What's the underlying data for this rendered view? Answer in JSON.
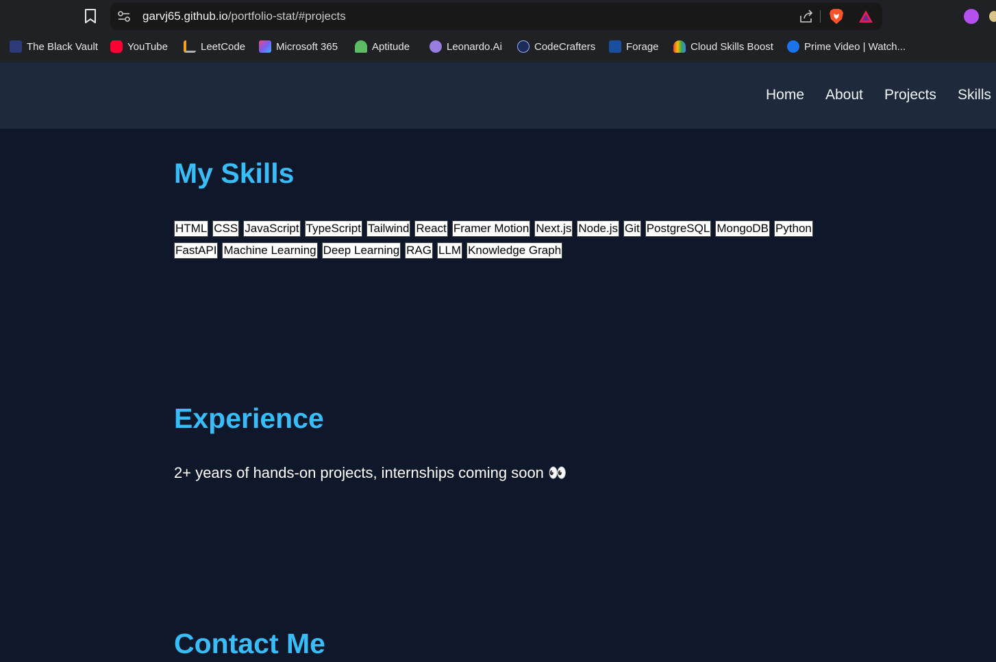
{
  "browser": {
    "url_host": "garvj65.github.io",
    "url_path": "/portfolio-stat/#projects"
  },
  "bookmarks": [
    {
      "label": "The Black Vault",
      "color": "#3a4a8a",
      "icon": "black-vault-icon"
    },
    {
      "label": "YouTube",
      "color": "#ff0033",
      "icon": "youtube-icon"
    },
    {
      "label": "LeetCode",
      "color": "#f89f1b",
      "icon": "leetcode-icon"
    },
    {
      "label": "Microsoft 365",
      "color": "#7b5cf0",
      "icon": "microsoft-365-icon"
    },
    {
      "label": "Aptitude",
      "color": "#5dbb63",
      "icon": "aptitude-icon"
    },
    {
      "label": "Leonardo.Ai",
      "color": "#9a7de0",
      "icon": "leonardo-icon"
    },
    {
      "label": "CodeCrafters",
      "color": "#1e2a5a",
      "icon": "codecrafters-icon"
    },
    {
      "label": "Forage",
      "color": "#1a4fa0",
      "icon": "forage-icon"
    },
    {
      "label": "Cloud Skills Boost",
      "color": "#ea4335",
      "icon": "google-cloud-icon"
    },
    {
      "label": "Prime Video | Watch...",
      "color": "#1a73e8",
      "icon": "prime-video-icon"
    }
  ],
  "nav": {
    "home": "Home",
    "about": "About",
    "projects": "Projects",
    "skills": "Skills"
  },
  "skills_section": {
    "title": "My Skills",
    "items": [
      "HTML",
      "CSS",
      "JavaScript",
      "TypeScript",
      "Tailwind",
      "React",
      "Framer Motion",
      "Next.js",
      "Node.js",
      "Git",
      "PostgreSQL",
      "MongoDB",
      "Python",
      "FastAPI",
      "Machine Learning",
      "Deep Learning",
      "RAG",
      "LLM",
      "Knowledge Graph"
    ]
  },
  "experience_section": {
    "title": "Experience",
    "text": "2+ years of hands-on projects, internships coming soon 👀"
  },
  "contact_section": {
    "title": "Contact Me"
  },
  "colors": {
    "page_bg": "#0f172a",
    "nav_bg": "#1e293b",
    "accent": "#38bdf8"
  }
}
